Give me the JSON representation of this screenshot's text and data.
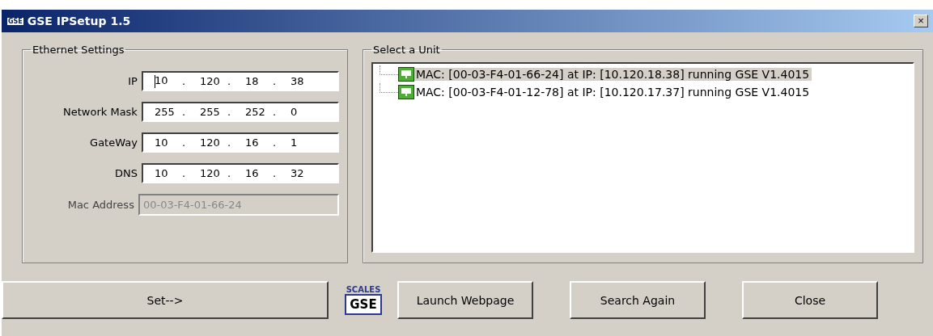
{
  "window": {
    "title": "GSE IPSetup 1.5",
    "icon_text": "GSE",
    "close": "×"
  },
  "ethernet": {
    "title": "Ethernet Settings",
    "separator": ".",
    "fields": [
      {
        "label": "IP",
        "octets": [
          "10",
          "120",
          "18",
          "38"
        ],
        "focused": true
      },
      {
        "label": "Network Mask",
        "octets": [
          "255",
          "255",
          "252",
          "0"
        ],
        "focused": false
      },
      {
        "label": "GateWay",
        "octets": [
          "10",
          "120",
          "16",
          "1"
        ],
        "focused": false
      },
      {
        "label": "DNS",
        "octets": [
          "10",
          "120",
          "16",
          "32"
        ],
        "focused": false
      }
    ],
    "mac": {
      "label": "Mac Address",
      "value": "00-03-F4-01-66-24",
      "disabled": true
    }
  },
  "units": {
    "title": "Select a Unit",
    "items": [
      {
        "text": "MAC: [00-03-F4-01-66-24] at IP: [10.120.18.38] running GSE V1.4015",
        "selected": true
      },
      {
        "text": "MAC: [00-03-F4-01-12-78] at IP: [10.120.17.37] running GSE V1.4015",
        "selected": false
      }
    ]
  },
  "buttons": [
    {
      "label": "Set-->",
      "kind": "wide"
    },
    {
      "kind": "logo",
      "top": "SCALES",
      "main": "GSE"
    },
    {
      "label": "Launch Webpage",
      "kind": "normal"
    },
    {
      "label": "Search Again",
      "kind": "normal"
    },
    {
      "label": "Close",
      "kind": "normal"
    }
  ]
}
